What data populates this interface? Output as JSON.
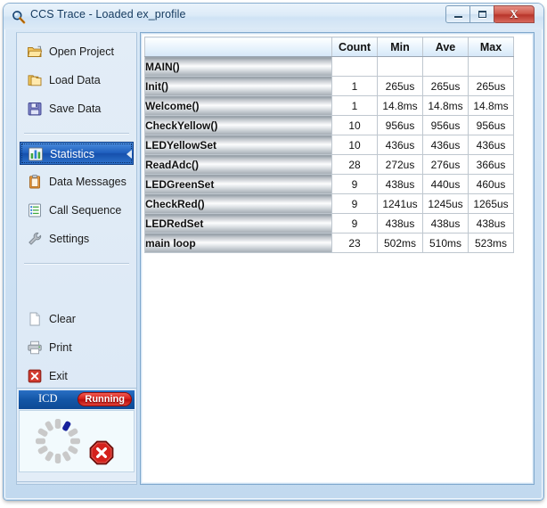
{
  "window": {
    "title": "CCS Trace - Loaded ex_profile",
    "icon": "magnifier-icon",
    "controls": {
      "minimize": "minimize-button",
      "maximize": "maximize-button",
      "close_glyph": "X"
    }
  },
  "sidebar": {
    "groups": [
      {
        "items": [
          {
            "label": "Open Project",
            "icon": "open-folder-icon",
            "selected": false
          },
          {
            "label": "Load Data",
            "icon": "folder-stack-icon",
            "selected": false
          },
          {
            "label": "Save Data",
            "icon": "floppy-disk-icon",
            "selected": false
          }
        ]
      },
      {
        "items": [
          {
            "label": "Statistics",
            "icon": "bar-chart-icon",
            "selected": true
          },
          {
            "label": "Data Messages",
            "icon": "clipboard-icon",
            "selected": false
          },
          {
            "label": "Call Sequence",
            "icon": "list-document-icon",
            "selected": false
          },
          {
            "label": "Settings",
            "icon": "wrench-icon",
            "selected": false
          }
        ]
      },
      {
        "items": [
          {
            "label": "Clear",
            "icon": "blank-page-icon",
            "selected": false
          },
          {
            "label": "Print",
            "icon": "printer-icon",
            "selected": false
          },
          {
            "label": "Exit",
            "icon": "red-x-icon",
            "selected": false
          }
        ]
      }
    ]
  },
  "icd": {
    "title": "ICD",
    "status_badge": "Running",
    "spinner": "loading-spinner-icon",
    "stop_button": "stop-button-icon",
    "colors": {
      "header": "#1356a6",
      "badge": "#d8201a",
      "spinner_active": "#16219c",
      "spinner_inactive": "#c9c9c9"
    }
  },
  "table": {
    "columns": [
      "",
      "Count",
      "Min",
      "Ave",
      "Max"
    ],
    "rows": [
      {
        "name": "MAIN()",
        "count": "",
        "min": "",
        "ave": "",
        "max": ""
      },
      {
        "name": "Init()",
        "count": "1",
        "min": "265us",
        "ave": "265us",
        "max": "265us"
      },
      {
        "name": "Welcome()",
        "count": "1",
        "min": "14.8ms",
        "ave": "14.8ms",
        "max": "14.8ms"
      },
      {
        "name": "CheckYellow()",
        "count": "10",
        "min": "956us",
        "ave": "956us",
        "max": "956us"
      },
      {
        "name": "LEDYellowSet",
        "count": "10",
        "min": "436us",
        "ave": "436us",
        "max": "436us"
      },
      {
        "name": "ReadAdc()",
        "count": "28",
        "min": "272us",
        "ave": "276us",
        "max": "366us"
      },
      {
        "name": "LEDGreenSet",
        "count": "9",
        "min": "438us",
        "ave": "440us",
        "max": "460us"
      },
      {
        "name": "CheckRed()",
        "count": "9",
        "min": "1241us",
        "ave": "1245us",
        "max": "1265us"
      },
      {
        "name": "LEDRedSet",
        "count": "9",
        "min": "438us",
        "ave": "438us",
        "max": "438us"
      },
      {
        "name": "main loop",
        "count": "23",
        "min": "502ms",
        "ave": "510ms",
        "max": "523ms"
      }
    ]
  }
}
